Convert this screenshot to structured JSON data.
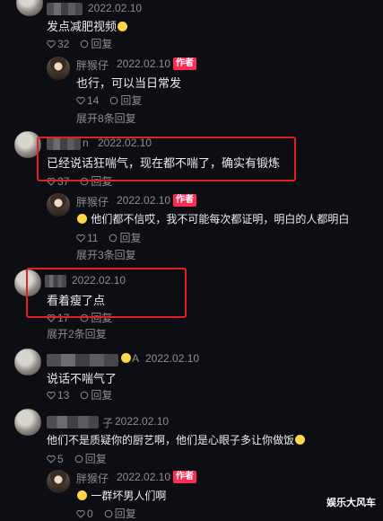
{
  "c1": {
    "date": "2022.02.10",
    "text": "发点减肥视频",
    "likes": "32",
    "reply": "回复"
  },
  "r1": {
    "name": "胖猴仔",
    "date": "2022.02.10",
    "badge": "作者",
    "text": "也行，可以当日常发",
    "likes": "14",
    "reply": "回复"
  },
  "e1": "展开8条回复",
  "c2": {
    "name_suffix": "n",
    "date": "2022.02.10",
    "text": "已经说话狂喘气，现在都不喘了，确实有锻炼",
    "likes": "37",
    "reply": "回复"
  },
  "r2": {
    "name": "胖猴仔",
    "date": "2022.02.10",
    "badge": "作者",
    "text": "他们都不信哎，我不可能每次都证明，明白的人都明白",
    "likes": "11",
    "reply": "回复"
  },
  "e2": "展开3条回复",
  "c3": {
    "date": "2022.02.10",
    "text": "看着瘦了点",
    "likes": "17",
    "reply": "回复"
  },
  "e3": "展开2条回复",
  "c4": {
    "name_suffix": "A",
    "date": "2022.02.10",
    "text": "说话不喘气了",
    "likes": "13",
    "reply": "回复"
  },
  "c5": {
    "name_suffix": "子",
    "date": "2022.02.10",
    "text": "他们不是质疑你的厨艺啊，他们是心眼子多让你做饭",
    "likes": "5",
    "reply": "回复"
  },
  "r5": {
    "name": "胖猴仔",
    "date": "2022.02.10",
    "badge": "作者",
    "text": "一群坏男人们啊",
    "likes": "0",
    "reply": "回复"
  },
  "watermark": "娱乐大风车",
  "icons": {
    "like": "heart-outline-icon",
    "reply": "reply-arrow-icon"
  },
  "colors": {
    "highlight": "#e02224",
    "badge": "#fe2c55",
    "bg": "#0d0e13"
  }
}
